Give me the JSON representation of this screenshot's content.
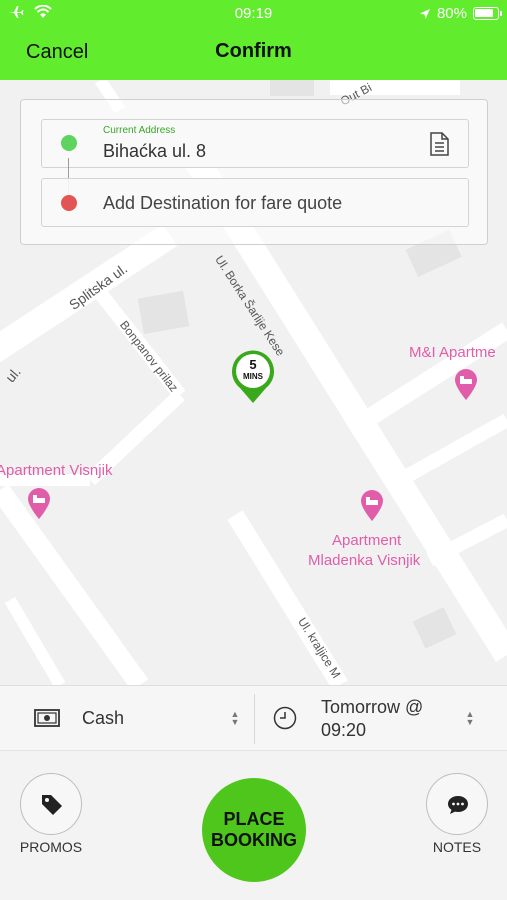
{
  "status_bar": {
    "time": "09:19",
    "battery": "80%"
  },
  "nav": {
    "cancel_label": "Cancel",
    "title": "Confirm"
  },
  "address": {
    "pickup_label": "Current Address",
    "pickup_value": "Bihaćka ul. 8",
    "destination_placeholder": "Add Destination for fare quote"
  },
  "marker": {
    "number": "5",
    "unit": "MINS"
  },
  "map": {
    "streets": [
      "Out Bi",
      "Splitska ul.",
      "ul.",
      "Ul. Borka Šarlije Kese",
      "Bonpanov prilaz",
      "Ul. kraljice M"
    ],
    "pois": [
      "M&I Apartme",
      "Apartment Visnjik",
      "Apartment",
      "Mladenka Visnjik"
    ]
  },
  "payment": {
    "method": "Cash",
    "time_line1": "Tomorrow @",
    "time_line2": "09:20"
  },
  "actions": {
    "promos_label": "PROMOS",
    "place_line1": "PLACE",
    "place_line2": "BOOKING",
    "notes_label": "NOTES"
  },
  "colors": {
    "accent": "#62ec2e",
    "button": "#4fc61c",
    "pickup_dot": "#5ed45f",
    "dest_dot": "#e35454",
    "poi": "#e05ea9"
  },
  "icons": [
    "airplane-icon",
    "wifi-icon",
    "location-arrow-icon",
    "battery-icon",
    "document-icon",
    "cash-icon",
    "clock-icon",
    "tag-icon",
    "chat-icon",
    "bed-icon"
  ]
}
